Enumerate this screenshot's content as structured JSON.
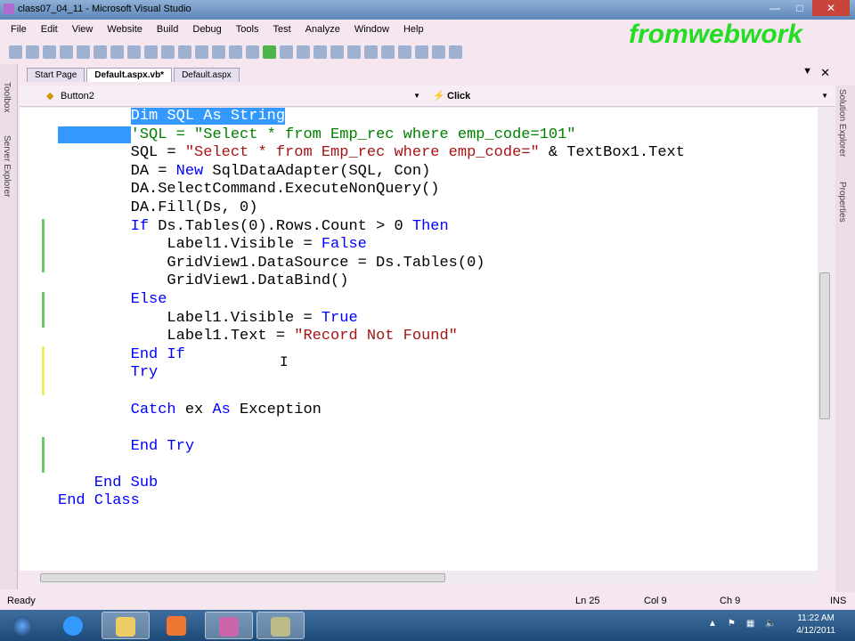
{
  "window": {
    "title": "class07_04_11 - Microsoft Visual Studio"
  },
  "menu": [
    "File",
    "Edit",
    "View",
    "Website",
    "Build",
    "Debug",
    "Tools",
    "Test",
    "Analyze",
    "Window",
    "Help"
  ],
  "watermark": "fromwebwork",
  "side_tabs": {
    "left": [
      "Toolbox",
      "Server Explorer"
    ],
    "right": [
      "Solution Explorer",
      "Properties"
    ]
  },
  "doc_tabs": [
    {
      "label": "Start Page"
    },
    {
      "label": "Default.aspx.vb*",
      "active": true
    },
    {
      "label": "Default.aspx"
    }
  ],
  "nav": {
    "object": "Button2",
    "event": "Click"
  },
  "code_lines": [
    [
      [
        "tx",
        "        "
      ],
      [
        "sel",
        "Dim SQL As String"
      ]
    ],
    [
      [
        "sel",
        "        "
      ],
      [
        "cm",
        "'SQL = \"Select * from Emp_rec where emp_code=101\""
      ]
    ],
    [
      [
        "tx",
        "        SQL = "
      ],
      [
        "str",
        "\"Select * from Emp_rec where emp_code=\""
      ],
      [
        "tx",
        " & TextBox1.Text"
      ]
    ],
    [
      [
        "tx",
        "        DA = "
      ],
      [
        "kw",
        "New"
      ],
      [
        "tx",
        " SqlDataAdapter(SQL, Con)"
      ]
    ],
    [
      [
        "tx",
        "        DA.SelectCommand.ExecuteNonQuery()"
      ]
    ],
    [
      [
        "tx",
        "        DA.Fill(Ds, 0)"
      ]
    ],
    [
      [
        "kw",
        "        If"
      ],
      [
        "tx",
        " Ds.Tables(0).Rows.Count > 0 "
      ],
      [
        "kw",
        "Then"
      ]
    ],
    [
      [
        "tx",
        "            Label1.Visible = "
      ],
      [
        "kw",
        "False"
      ]
    ],
    [
      [
        "tx",
        "            GridView1.DataSource = Ds.Tables(0)"
      ]
    ],
    [
      [
        "tx",
        "            GridView1.DataBind()"
      ]
    ],
    [
      [
        "kw",
        "        Else"
      ]
    ],
    [
      [
        "tx",
        "            Label1.Visible = "
      ],
      [
        "kw",
        "True"
      ]
    ],
    [
      [
        "tx",
        "            Label1.Text = "
      ],
      [
        "str",
        "\"Record Not Found\""
      ]
    ],
    [
      [
        "kw",
        "        End If"
      ]
    ],
    [
      [
        "kw",
        "        Try"
      ]
    ],
    [],
    [
      [
        "kw",
        "        Catch"
      ],
      [
        "tx",
        " ex "
      ],
      [
        "kw",
        "As"
      ],
      [
        "tx",
        " Exception"
      ]
    ],
    [],
    [
      [
        "kw",
        "        End Try"
      ]
    ],
    [],
    [
      [
        "kw",
        "    End Sub"
      ]
    ],
    [
      [
        "kw",
        "End Class"
      ]
    ]
  ],
  "status": {
    "text": "Ready",
    "ln": "Ln 25",
    "col": "Col 9",
    "ch": "Ch 9",
    "mode": "INS"
  },
  "clock": {
    "time": "11:22 AM",
    "date": "4/12/2011"
  }
}
